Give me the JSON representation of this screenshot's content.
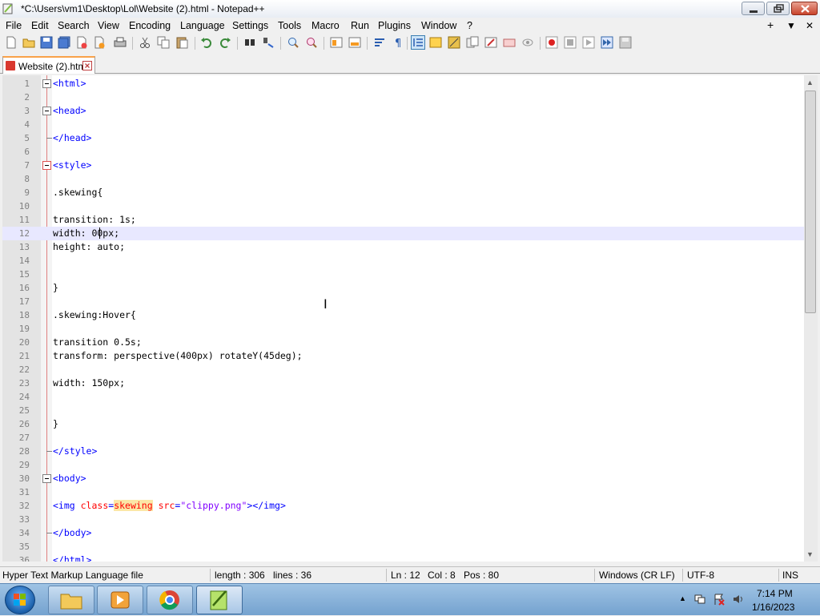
{
  "window": {
    "title": "*C:\\Users\\vm1\\Desktop\\Lol\\Website (2).html - Notepad++"
  },
  "menu": {
    "items": [
      "File",
      "Edit",
      "Search",
      "View",
      "Encoding",
      "Language",
      "Settings",
      "Tools",
      "Macro",
      "Run",
      "Plugins",
      "Window",
      "?"
    ],
    "right": [
      "+",
      "▼",
      "✕"
    ]
  },
  "toolbar": {
    "icons": [
      "new-file-icon",
      "open-file-icon",
      "save-icon",
      "save-all-icon",
      "close-icon",
      "close-all-icon",
      "print-icon",
      "cut-icon",
      "copy-icon",
      "paste-icon",
      "undo-icon",
      "redo-icon",
      "find-icon",
      "replace-icon",
      "zoom-in-icon",
      "zoom-out-icon",
      "sync-vertical-icon",
      "sync-horizontal-icon",
      "word-wrap-icon",
      "show-all-chars-icon",
      "indent-guide-icon",
      "udl-icon",
      "doc-map-icon",
      "function-list-icon",
      "folder-workspace-icon",
      "monitoring-icon",
      "record-macro-icon",
      "stop-record-icon",
      "play-macro-icon",
      "run-macro-multiple-icon",
      "save-macro-icon"
    ]
  },
  "tab": {
    "label": "Website (2).html"
  },
  "editor": {
    "current_line": 12,
    "lines": [
      {
        "n": "1",
        "segs": [
          {
            "t": "<html>",
            "c": "tag"
          }
        ]
      },
      {
        "n": "2",
        "segs": []
      },
      {
        "n": "3",
        "segs": [
          {
            "t": "<head>",
            "c": "tag"
          }
        ]
      },
      {
        "n": "4",
        "segs": []
      },
      {
        "n": "5",
        "segs": [
          {
            "t": "</head>",
            "c": "tag"
          }
        ]
      },
      {
        "n": "6",
        "segs": []
      },
      {
        "n": "7",
        "segs": [
          {
            "t": "<style>",
            "c": "tag"
          }
        ]
      },
      {
        "n": "8",
        "segs": []
      },
      {
        "n": "9",
        "segs": [
          {
            "t": ".skewing{",
            "c": ""
          }
        ]
      },
      {
        "n": "10",
        "segs": []
      },
      {
        "n": "11",
        "segs": [
          {
            "t": "transition: 1s;",
            "c": ""
          }
        ]
      },
      {
        "n": "12",
        "segs": [
          {
            "t": "width: 00px;",
            "c": ""
          }
        ]
      },
      {
        "n": "13",
        "segs": [
          {
            "t": "height: auto;",
            "c": ""
          }
        ]
      },
      {
        "n": "14",
        "segs": []
      },
      {
        "n": "15",
        "segs": []
      },
      {
        "n": "16",
        "segs": [
          {
            "t": "}",
            "c": ""
          }
        ]
      },
      {
        "n": "17",
        "segs": []
      },
      {
        "n": "18",
        "segs": [
          {
            "t": ".skewing:Hover{",
            "c": ""
          }
        ]
      },
      {
        "n": "19",
        "segs": []
      },
      {
        "n": "20",
        "segs": [
          {
            "t": "transition 0.5s;",
            "c": ""
          }
        ]
      },
      {
        "n": "21",
        "segs": [
          {
            "t": "transform: perspective(400px) rotateY(45deg);",
            "c": ""
          }
        ]
      },
      {
        "n": "22",
        "segs": []
      },
      {
        "n": "23",
        "segs": [
          {
            "t": "width: 150px;",
            "c": ""
          }
        ]
      },
      {
        "n": "24",
        "segs": []
      },
      {
        "n": "25",
        "segs": []
      },
      {
        "n": "26",
        "segs": [
          {
            "t": "}",
            "c": ""
          }
        ]
      },
      {
        "n": "27",
        "segs": []
      },
      {
        "n": "28",
        "segs": [
          {
            "t": "</style>",
            "c": "tag"
          }
        ]
      },
      {
        "n": "29",
        "segs": []
      },
      {
        "n": "30",
        "segs": [
          {
            "t": "<body>",
            "c": "tag"
          }
        ]
      },
      {
        "n": "31",
        "segs": []
      },
      {
        "n": "32",
        "segs": [
          {
            "t": "<img ",
            "c": "tag"
          },
          {
            "t": "class",
            "c": "attr"
          },
          {
            "t": "=",
            "c": "tag"
          },
          {
            "t": "skewing",
            "c": "attr hl"
          },
          {
            "t": " ",
            "c": ""
          },
          {
            "t": "src",
            "c": "attr"
          },
          {
            "t": "=",
            "c": "tag"
          },
          {
            "t": "\"clippy.png\"",
            "c": "attrval"
          },
          {
            "t": "></img>",
            "c": "tag"
          }
        ]
      },
      {
        "n": "33",
        "segs": []
      },
      {
        "n": "34",
        "segs": [
          {
            "t": "</body>",
            "c": "tag"
          }
        ]
      },
      {
        "n": "35",
        "segs": []
      },
      {
        "n": "36",
        "segs": [
          {
            "t": "</html>",
            "c": "tag"
          }
        ]
      }
    ]
  },
  "statusbar": {
    "file_type": "Hyper Text Markup Language file",
    "length": "length : 306",
    "lines": "lines : 36",
    "ln": "Ln : 12",
    "col": "Col : 8",
    "pos": "Pos : 80",
    "eol": "Windows (CR LF)",
    "encoding": "UTF-8",
    "mode": "INS"
  },
  "taskbar": {
    "time": "7:14 PM",
    "date": "1/16/2023"
  },
  "colors": {
    "tag": "#0000ff",
    "attr": "#ff0000",
    "attrval": "#8000ff",
    "current_line": "#e8e8ff",
    "fold_marker": "#e05050"
  }
}
